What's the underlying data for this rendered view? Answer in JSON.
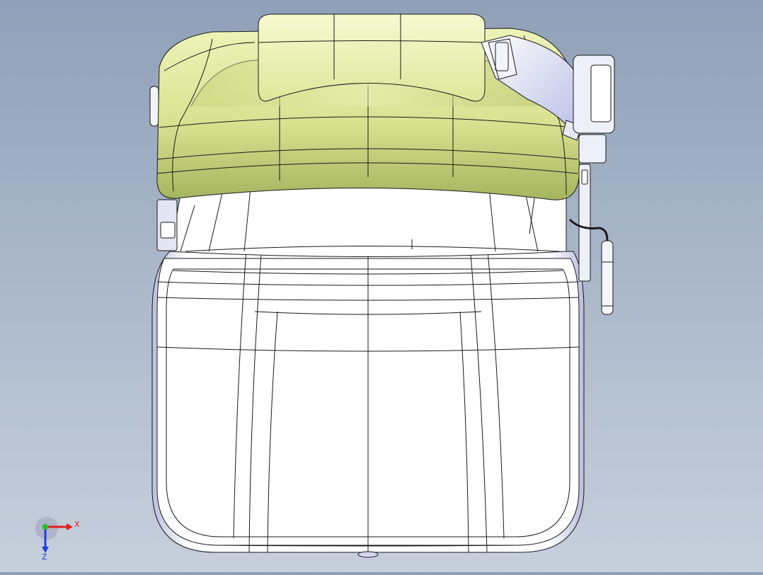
{
  "viewport": {
    "model": "seat-top-view",
    "background_top": "#8fa0b8",
    "background_bottom": "#c7cfdc"
  },
  "colors": {
    "headrest": "#e6eea6",
    "headrest_shadow": "#9fae55",
    "seat_body": "#ffffff",
    "seat_edge": "#c9cde8",
    "edges": "#1a1a1a"
  },
  "triad": {
    "x_label": "X",
    "z_label": "Z",
    "x_color": "#e02020",
    "y_color": "#20c020",
    "z_color": "#2040e0"
  }
}
